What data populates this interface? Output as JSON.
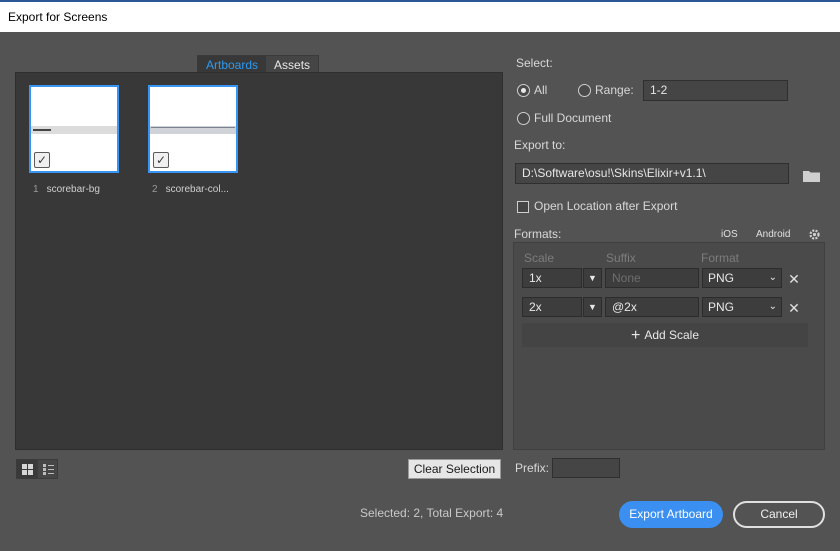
{
  "window": {
    "title": "Export for Screens"
  },
  "tabs": [
    {
      "label": "Artboards"
    },
    {
      "label": "Assets"
    }
  ],
  "artboards": [
    {
      "num": "1",
      "name": "scorebar-bg"
    },
    {
      "num": "2",
      "name": "scorebar-col..."
    }
  ],
  "footer": {
    "clear_selection": "Clear Selection",
    "status": "Selected: 2, Total Export: 4",
    "export_button": "Export Artboard",
    "cancel_button": "Cancel"
  },
  "select": {
    "label": "Select:",
    "all": "All",
    "range": "Range:",
    "range_value": "1-2",
    "full_document": "Full Document",
    "selected_option": "All"
  },
  "export_to": {
    "label": "Export to:",
    "path": "D:\\Software\\osu!\\Skins\\Elixir+v1.1\\",
    "open_location": "Open Location after Export"
  },
  "formats": {
    "label": "Formats:",
    "ios": "iOS",
    "android": "Android",
    "col_scale": "Scale",
    "col_suffix": "Suffix",
    "col_format": "Format",
    "rows": [
      {
        "scale": "1x",
        "suffix": "",
        "suffix_placeholder": "None",
        "format": "PNG"
      },
      {
        "scale": "2x",
        "suffix": "@2x",
        "suffix_placeholder": "",
        "format": "PNG"
      }
    ],
    "add_scale": "Add Scale"
  },
  "prefix": {
    "label": "Prefix:",
    "value": ""
  },
  "colors": {
    "accent": "#3a8ff0",
    "selection_border": "#3895f3"
  }
}
